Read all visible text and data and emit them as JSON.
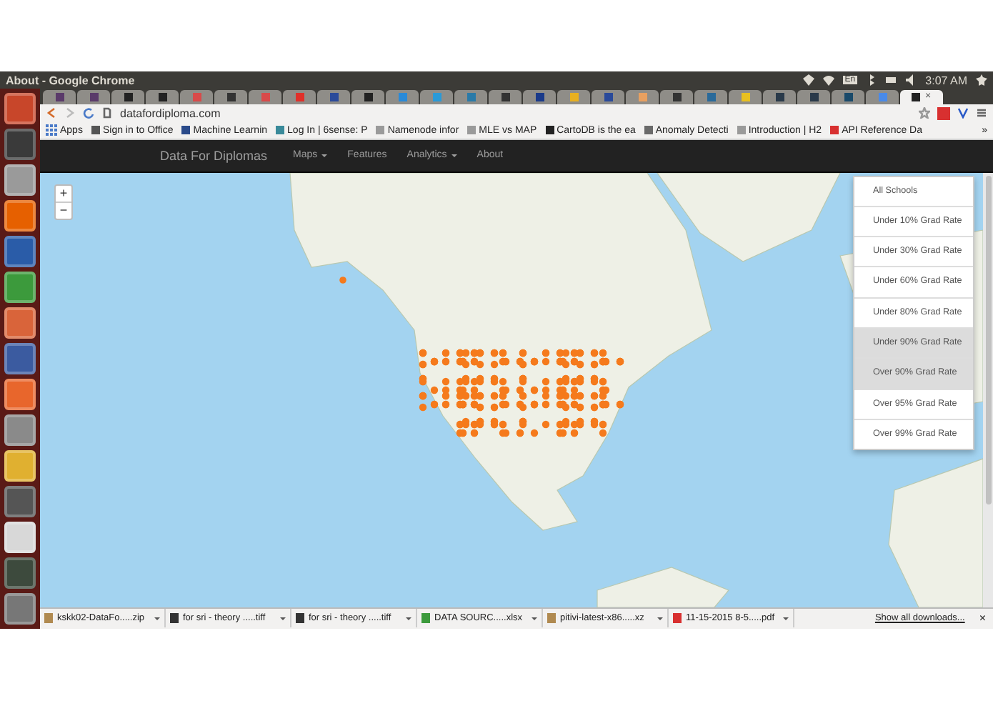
{
  "panel": {
    "title": "About - Google Chrome",
    "keyboard": "En",
    "clock": "3:07 AM"
  },
  "launcher": [
    {
      "color": "#c8462a"
    },
    {
      "color": "#3a3a3a"
    },
    {
      "color": "#9a9a9a"
    },
    {
      "color": "#e66000"
    },
    {
      "color": "#2a5ca8"
    },
    {
      "color": "#3c9a3c"
    },
    {
      "color": "#d9643a"
    },
    {
      "color": "#3b5ba0"
    },
    {
      "color": "#e8662c"
    },
    {
      "color": "#8a8a8a"
    },
    {
      "color": "#e0b030"
    },
    {
      "color": "#555555"
    },
    {
      "color": "#d8d8d8"
    },
    {
      "color": "#3d4a3d"
    },
    {
      "color": "#777777"
    }
  ],
  "tabs": [
    {
      "color": "#5a3a6a",
      "selected": false
    },
    {
      "color": "#5a3a6a",
      "selected": false
    },
    {
      "color": "#222222",
      "selected": false
    },
    {
      "color": "#222222",
      "selected": false
    },
    {
      "color": "#d84a4a",
      "selected": false
    },
    {
      "color": "#333333",
      "selected": false
    },
    {
      "color": "#d84a4a",
      "selected": false
    },
    {
      "color": "#e0302a",
      "selected": false
    },
    {
      "color": "#2a4a9a",
      "selected": false
    },
    {
      "color": "#222222",
      "selected": false
    },
    {
      "color": "#2a8ad8",
      "selected": false
    },
    {
      "color": "#2a9ad8",
      "selected": false
    },
    {
      "color": "#2a7aa8",
      "selected": false
    },
    {
      "color": "#333333",
      "selected": false
    },
    {
      "color": "#1a3a8a",
      "selected": false
    },
    {
      "color": "#e8b020",
      "selected": false
    },
    {
      "color": "#2a4a9a",
      "selected": false
    },
    {
      "color": "#e8a060",
      "selected": false
    },
    {
      "color": "#333333",
      "selected": false
    },
    {
      "color": "#2a6a9a",
      "selected": false
    },
    {
      "color": "#e8c020",
      "selected": false
    },
    {
      "color": "#2a3a4a",
      "selected": false
    },
    {
      "color": "#2a3a4a",
      "selected": false
    },
    {
      "color": "#1a4a6a",
      "selected": false
    },
    {
      "color": "#4a8ae8",
      "selected": false
    },
    {
      "color": "#222222",
      "selected": true
    }
  ],
  "tab_close": "×",
  "address": "datafordiploma.com",
  "bookmarks": {
    "apps": "Apps",
    "items": [
      {
        "label": "Sign in to Office",
        "color": "#555555"
      },
      {
        "label": "Machine Learnin",
        "color": "#2a4a8a"
      },
      {
        "label": "Log In | 6sense: P",
        "color": "#3a8a9a"
      },
      {
        "label": "Namenode infor",
        "color": "#9a9a9a"
      },
      {
        "label": "MLE vs MAP",
        "color": "#9a9a9a"
      },
      {
        "label": "CartoDB is the ea",
        "color": "#222222"
      },
      {
        "label": "Anomaly Detecti",
        "color": "#6a6a6a"
      },
      {
        "label": "Introduction | H2",
        "color": "#9a9a9a"
      },
      {
        "label": "API Reference Da",
        "color": "#d83030"
      }
    ],
    "more": "»"
  },
  "nav": {
    "brand": "Data For Diplomas",
    "items": [
      {
        "label": "Maps",
        "dropdown": true
      },
      {
        "label": "Features",
        "dropdown": false
      },
      {
        "label": "Analytics",
        "dropdown": true
      },
      {
        "label": "About",
        "dropdown": false
      }
    ]
  },
  "map": {
    "zoom_in": "+",
    "zoom_out": "−",
    "filters": [
      {
        "label": "All Schools",
        "highlighted": false
      },
      {
        "label": "Under 10% Grad Rate",
        "highlighted": false
      },
      {
        "label": "Under 30% Grad Rate",
        "highlighted": false
      },
      {
        "label": "Under 60% Grad Rate",
        "highlighted": false
      },
      {
        "label": "Under 80% Grad Rate",
        "highlighted": false
      },
      {
        "label": "Under 90% Grad Rate",
        "highlighted": true
      },
      {
        "label": "Over 90% Grad Rate",
        "highlighted": true
      },
      {
        "label": "Over 95% Grad Rate",
        "highlighted": false
      },
      {
        "label": "Over 99% Grad Rate",
        "highlighted": false
      }
    ]
  },
  "downloads": {
    "items": [
      {
        "name": "kskk02-DataFo.....zip",
        "color": "#b08a50"
      },
      {
        "name": "for sri - theory .....tiff",
        "color": "#333333"
      },
      {
        "name": "for sri - theory .....tiff",
        "color": "#333333"
      },
      {
        "name": "DATA SOURC.....xlsx",
        "color": "#3c9a3c"
      },
      {
        "name": "pitivi-latest-x86.....xz",
        "color": "#b08a50"
      },
      {
        "name": "11-15-2015 8-5.....pdf",
        "color": "#d83030"
      }
    ],
    "show_all": "Show all downloads...",
    "close": "×"
  }
}
